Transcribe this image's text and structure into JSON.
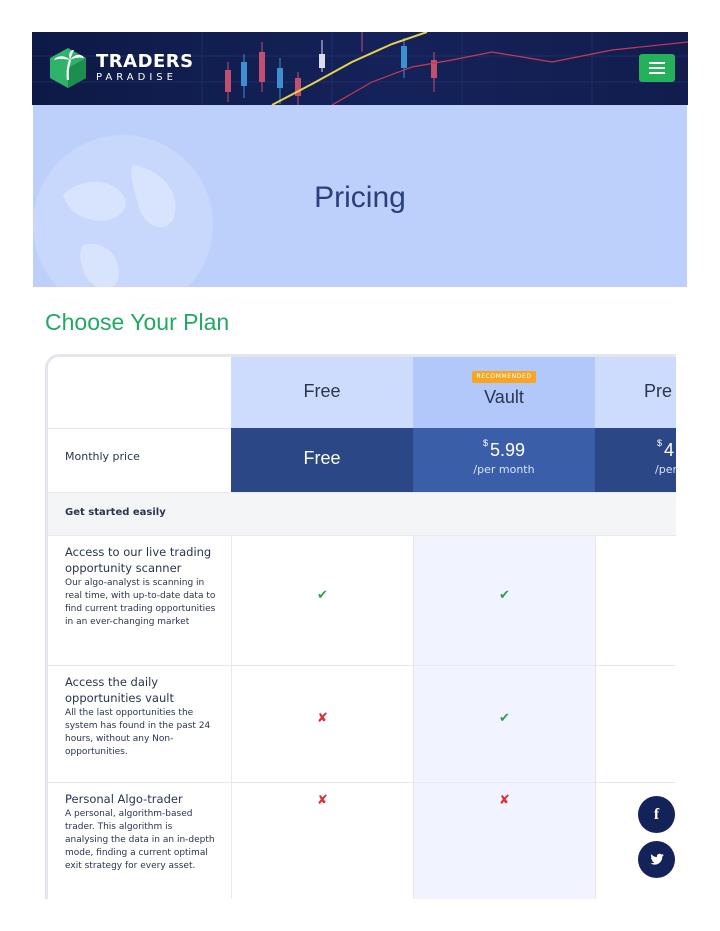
{
  "brand": {
    "title": "TRADERS",
    "subtitle": "PARADISE"
  },
  "hero": {
    "title": "Pricing"
  },
  "section": {
    "title": "Choose Your Plan"
  },
  "plans": [
    {
      "name": "Free",
      "badge": "",
      "price": "Free",
      "currency": "",
      "period": ""
    },
    {
      "name": "Vault",
      "badge": "RECOMMENDED",
      "price": "5.99",
      "currency": "$",
      "period": "/per month"
    },
    {
      "name": "Pre",
      "badge": "",
      "price": "4",
      "currency": "$",
      "period": "/per"
    }
  ],
  "table": {
    "price_label": "Monthly price",
    "group_label": "Get started easily",
    "features": [
      {
        "title": "Access to our live trading opportunity scanner",
        "description": "Our algo-analyst is scanning in real time, with up-to-date data to find current trading opportunities in an ever-changing market",
        "free": "✔",
        "vault": "✔",
        "free_ok": true,
        "vault_ok": true
      },
      {
        "title": "Access the daily opportunities vault",
        "description": "All the last opportunities the system has found in the past 24 hours, without any Non-opportunities.",
        "free": "✘",
        "vault": "✔",
        "free_ok": false,
        "vault_ok": true
      },
      {
        "title": "Personal Algo-trader",
        "description": "A personal, algorithm-based trader. This algorithm is analysing the data in an in-depth mode, finding a current optimal exit strategy for every asset.",
        "free": "✘",
        "vault": "✘",
        "free_ok": false,
        "vault_ok": false
      }
    ]
  },
  "social": {
    "facebook": "f",
    "twitter": "t"
  },
  "colors": {
    "accent_green": "#25b15a",
    "navy": "#14225a",
    "hero_bg": "#bcd0fb"
  }
}
